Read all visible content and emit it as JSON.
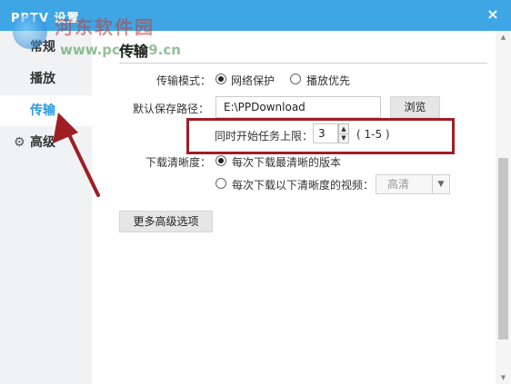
{
  "window": {
    "title": "PPTV 设置",
    "close_label": "×"
  },
  "watermark": {
    "text": "河东软件园",
    "url": "www.pc0359.cn"
  },
  "sidebar": {
    "items": [
      {
        "label": "常规"
      },
      {
        "label": "播放"
      },
      {
        "label": "传输"
      },
      {
        "label": "高级"
      }
    ],
    "active_index": 2
  },
  "main": {
    "section_title": "传输",
    "transfer_mode": {
      "label": "传输模式：",
      "options": [
        "网络保护",
        "播放优先"
      ],
      "selected_index": 0
    },
    "save_path": {
      "label": "默认保存路径：",
      "value": "E:\\PPDownload",
      "browse_label": "浏览"
    },
    "concurrent": {
      "label": "同时开始任务上限：",
      "value": "3",
      "range": "( 1-5 )"
    },
    "quality": {
      "label": "下载清晰度：",
      "options": [
        "每次下载最清晰的版本",
        "每次下载以下清晰度的视频："
      ],
      "selected_index": 0,
      "select_value": "高清"
    },
    "more_button": "更多高级选项"
  },
  "colors": {
    "titlebar": "#3fa6e6",
    "accent": "#2a9be0",
    "highlight": "#9e1e24"
  },
  "icons": {
    "close": "close-icon",
    "gear": "gear-icon",
    "spin_up": "chevron-up-icon",
    "spin_down": "chevron-down-icon",
    "select": "chevron-down-icon"
  }
}
